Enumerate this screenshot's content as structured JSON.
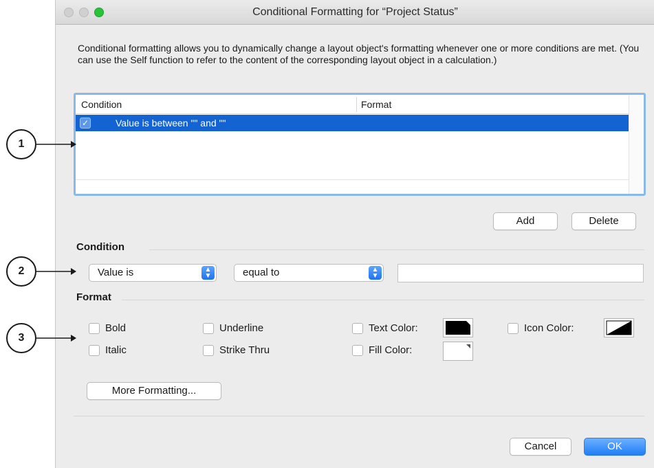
{
  "window": {
    "title": "Conditional Formatting for “Project Status”",
    "description": "Conditional formatting allows you to dynamically change a layout object's formatting whenever one or more conditions are met.  (You can use the Self function to refer to the content of the corresponding layout object in a calculation.)"
  },
  "table": {
    "columns": [
      "Condition",
      "Format"
    ],
    "rows": [
      {
        "checked": true,
        "condition": "Value is between \"\" and \"\"",
        "format": "",
        "selected": true
      }
    ]
  },
  "buttons": {
    "add": "Add",
    "delete": "Delete",
    "more_formatting": "More Formatting...",
    "cancel": "Cancel",
    "ok": "OK"
  },
  "condition": {
    "label": "Condition",
    "type_value": "Value is",
    "operator_value": "equal to",
    "value_field": ""
  },
  "format": {
    "label": "Format",
    "bold": "Bold",
    "italic": "Italic",
    "underline": "Underline",
    "strike_thru": "Strike Thru",
    "text_color": "Text Color:",
    "fill_color": "Fill Color:",
    "icon_color": "Icon Color:",
    "text_color_hex": "#000000",
    "fill_color_hex": "#ffffff",
    "icon_color_hex": "#000000"
  },
  "callouts": [
    "1",
    "2",
    "3"
  ],
  "colors": {
    "selection": "#1463d2",
    "accent": "#1f7ff5",
    "focus_ring": "#8ab8e8",
    "traffic_zoom": "#2ac23c"
  },
  "icons": {
    "checkmark": "checkmark-icon",
    "popup_arrows": "chevron-updown-icon"
  }
}
